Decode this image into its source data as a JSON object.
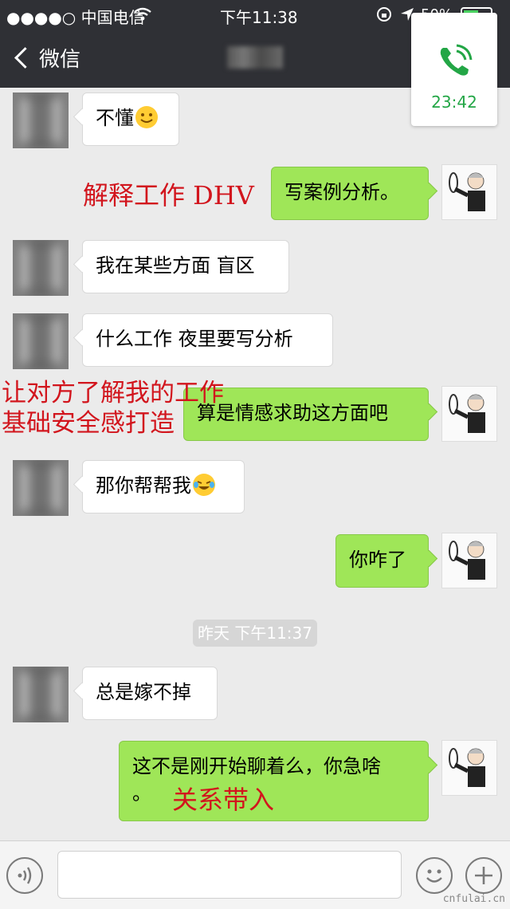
{
  "status_bar": {
    "carrier": "●●●●○ 中国电信",
    "time": "下午11:38",
    "battery": "50%"
  },
  "nav": {
    "back_label": "微信"
  },
  "call_card": {
    "duration": "23:42",
    "accent_color": "#23a646"
  },
  "messages": [
    {
      "side": "in",
      "text": "不懂",
      "emoji": "smile-emoji"
    },
    {
      "side": "out",
      "text": "写案例分析。"
    },
    {
      "side": "in",
      "text": "我在某些方面 盲区"
    },
    {
      "side": "in",
      "text": "什么工作 夜里要写分析"
    },
    {
      "side": "out",
      "text": "算是情感求助这方面吧"
    },
    {
      "side": "in",
      "text": "那你帮帮我",
      "emoji": "laugh-cry-emoji"
    },
    {
      "side": "out",
      "text": "你咋了"
    },
    {
      "side": "in",
      "text": "总是嫁不掉"
    },
    {
      "side": "out",
      "text": "这不是刚开始聊着么，你急啥",
      "text_line2": "。"
    }
  ],
  "timestamp": "昨天 下午11:37",
  "annotations": {
    "a1": "解释工作 DHV",
    "a2_line1": "让对方了解我的工作",
    "a2_line2": "基础安全感打造",
    "a3": "关系带入",
    "color": "#d2151d"
  },
  "watermark": "cnfulai.cn"
}
